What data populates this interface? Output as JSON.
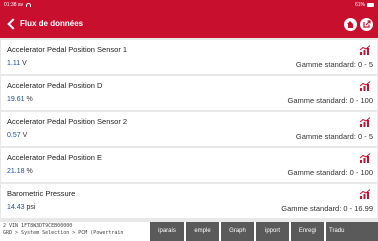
{
  "statusbar": {
    "time": "01:38 av",
    "battery": "61%"
  },
  "header": {
    "title": "Flux de données"
  },
  "rows": [
    {
      "name": "Accelerator Pedal Position Sensor 1",
      "value": "1.11",
      "unit": "V",
      "range": "Gamme standard: 0 - 5"
    },
    {
      "name": "Accelerator Pedal Position D",
      "value": "19.61",
      "unit": "%",
      "range": "Gamme standard: 0 - 100"
    },
    {
      "name": "Accelerator Pedal Position Sensor 2",
      "value": "0.57",
      "unit": "V",
      "range": "Gamme standard: 0 - 5"
    },
    {
      "name": "Accelerator Pedal Position E",
      "value": "21.18",
      "unit": "%",
      "range": "Gamme standard: 0 - 100"
    },
    {
      "name": "Barometric Pressure",
      "value": "14.43",
      "unit": "psi",
      "range": "Gamme standard: 0 - 16.99"
    }
  ],
  "bottom": {
    "info_line1": "2  VIN  1FT8W3DT9CEB00000",
    "info_line2": "GRD > System Selection > PCM (Powertrain",
    "buttons": [
      "iparais",
      "emple",
      "Graph",
      "ipport",
      "Enregi",
      "Tradu"
    ]
  },
  "colors": {
    "header": "#c8102e",
    "value": "#1d4ea0",
    "button": "#5a5a5a"
  }
}
